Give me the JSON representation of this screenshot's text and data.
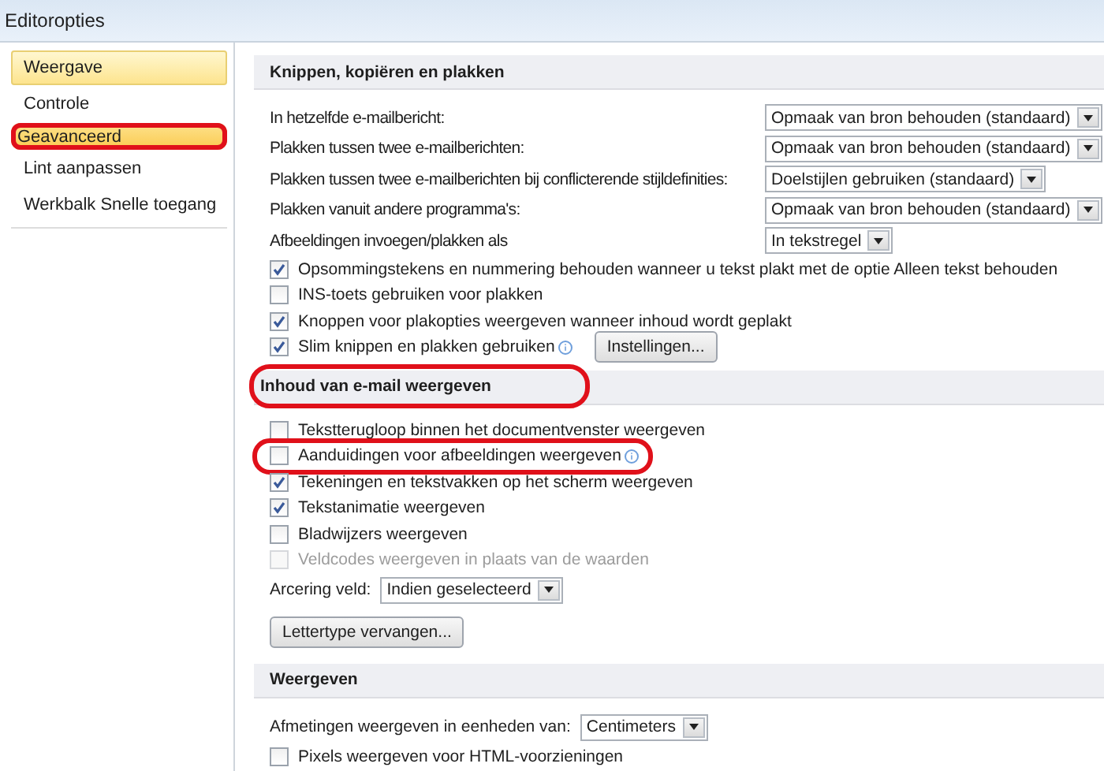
{
  "window": {
    "title": "Editoropties"
  },
  "sidebar": {
    "items": [
      {
        "label": "Weergave",
        "selected": false,
        "hovered": true,
        "highlighted": false
      },
      {
        "label": "Controle",
        "selected": false,
        "hovered": false,
        "highlighted": false
      },
      {
        "label": "Geavanceerd",
        "selected": true,
        "hovered": false,
        "highlighted": true
      },
      {
        "label": "Lint aanpassen",
        "selected": false,
        "hovered": false,
        "highlighted": false
      },
      {
        "label": "Werkbalk Snelle toegang",
        "selected": false,
        "hovered": false,
        "highlighted": false
      }
    ]
  },
  "sections": [
    {
      "title": "Knippen, kopiëren en plakken",
      "highlighted": false,
      "items": [
        {
          "kind": "select",
          "label": "In hetzelfde e-mailbericht:",
          "value": "Opmaak van bron behouden (standaard)"
        },
        {
          "kind": "select",
          "label": "Plakken tussen twee e-mailberichten:",
          "value": "Opmaak van bron behouden (standaard)"
        },
        {
          "kind": "select",
          "label": "Plakken tussen twee e-mailberichten bij conflicterende stijldefinities:",
          "value": "Doelstijlen gebruiken (standaard)"
        },
        {
          "kind": "select",
          "label": "Plakken vanuit andere programma's:",
          "value": "Opmaak van bron behouden (standaard)"
        },
        {
          "kind": "select",
          "label": "Afbeeldingen invoegen/plakken als",
          "value": "In tekstregel"
        },
        {
          "kind": "checkbox",
          "label": "Opsommingstekens en nummering behouden wanneer u tekst plakt met de optie Alleen tekst behouden",
          "checked": true,
          "disabled": false,
          "highlighted": false
        },
        {
          "kind": "checkbox",
          "label": "INS-toets gebruiken voor plakken",
          "checked": false,
          "disabled": false,
          "highlighted": false
        },
        {
          "kind": "checkbox",
          "label": "Knoppen voor plakopties weergeven wanneer inhoud wordt geplakt",
          "checked": true,
          "disabled": false,
          "highlighted": false
        },
        {
          "kind": "checkbox",
          "label": "Slim knippen en plakken gebruiken",
          "checked": true,
          "disabled": false,
          "highlighted": false,
          "info": true,
          "button": "Instellingen..."
        }
      ]
    },
    {
      "title": "Inhoud van e-mail weergeven",
      "highlighted": true,
      "items": [
        {
          "kind": "checkbox",
          "label": "Tekstterugloop binnen het documentvenster weergeven",
          "checked": false,
          "disabled": false,
          "highlighted": false
        },
        {
          "kind": "checkbox",
          "label": "Aanduidingen voor afbeeldingen weergeven",
          "checked": false,
          "disabled": false,
          "highlighted": true,
          "info": true
        },
        {
          "kind": "checkbox",
          "label": "Tekeningen en tekstvakken op het scherm weergeven",
          "checked": true,
          "disabled": false,
          "highlighted": false
        },
        {
          "kind": "checkbox",
          "label": "Tekstanimatie weergeven",
          "checked": true,
          "disabled": false,
          "highlighted": false
        },
        {
          "kind": "checkbox",
          "label": "Bladwijzers weergeven",
          "checked": false,
          "disabled": false,
          "highlighted": false
        },
        {
          "kind": "checkbox",
          "label": "Veldcodes weergeven in plaats van de waarden",
          "checked": false,
          "disabled": true,
          "highlighted": false
        },
        {
          "kind": "inline-select",
          "label": "Arcering veld:",
          "value": "Indien geselecteerd"
        },
        {
          "kind": "button",
          "label": "Lettertype vervangen..."
        }
      ]
    },
    {
      "title": "Weergeven",
      "highlighted": false,
      "items": [
        {
          "kind": "inline-select",
          "label": "Afmetingen weergeven in eenheden van:",
          "value": "Centimeters"
        },
        {
          "kind": "checkbox",
          "label": "Pixels weergeven voor HTML-voorzieningen",
          "checked": false,
          "disabled": false,
          "highlighted": false
        }
      ]
    }
  ]
}
